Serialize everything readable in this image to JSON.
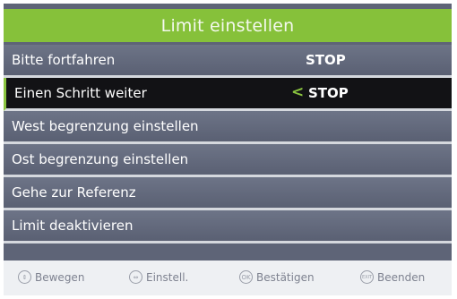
{
  "title": "Limit einstellen",
  "menu": [
    {
      "label": "Bitte fortfahren",
      "value": "STOP"
    },
    {
      "label": "Einen Schritt weiter",
      "value": "STOP",
      "arrow": "<"
    },
    {
      "label": "West begrenzung einstellen"
    },
    {
      "label": "Ost begrenzung einstellen"
    },
    {
      "label": "Gehe zur Referenz"
    },
    {
      "label": "Limit deaktivieren"
    }
  ],
  "footer": {
    "move": "Bewegen",
    "adjust": "Einstell.",
    "confirm": "Bestätigen",
    "exit": "Beenden",
    "ok_key": "OK",
    "exit_key": "EXIT"
  },
  "colors": {
    "accent": "#86c13a",
    "selected_bg": "#121215",
    "row_bg": "#5e6477"
  }
}
